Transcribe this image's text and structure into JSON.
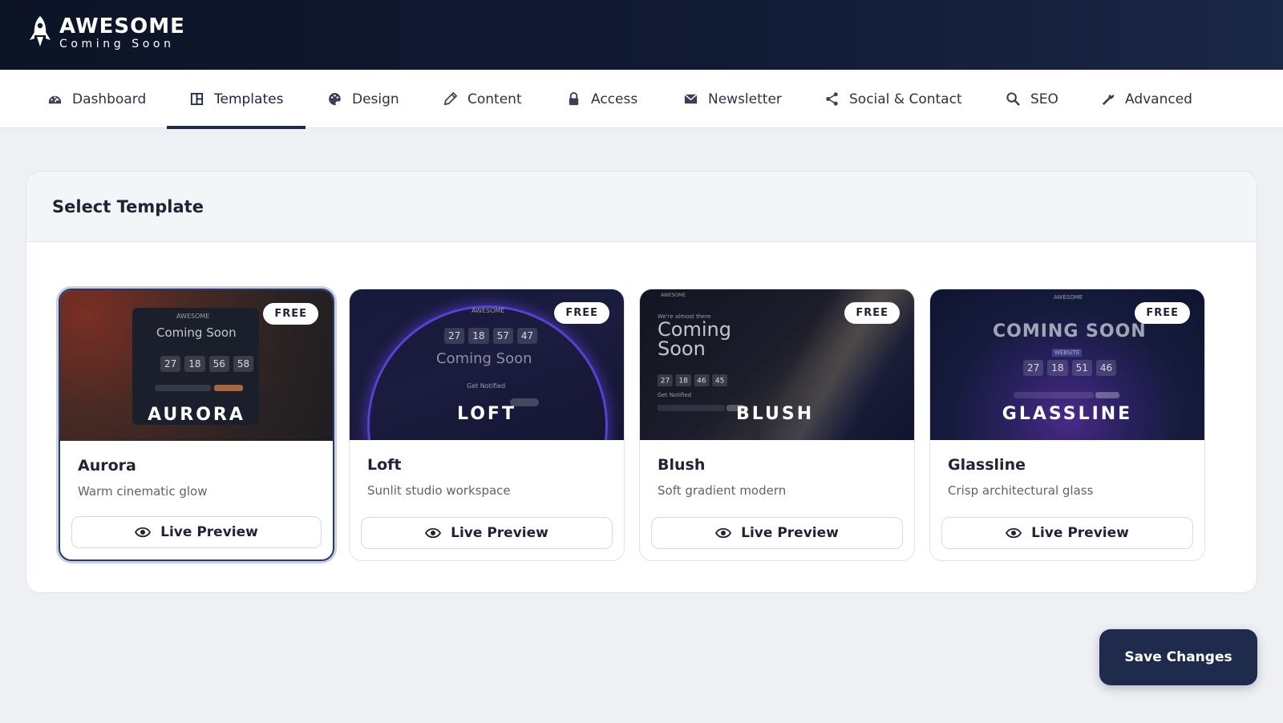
{
  "header": {
    "brand_title": "AWESOME",
    "brand_subtitle": "Coming Soon"
  },
  "nav": {
    "items": [
      {
        "label": "Dashboard",
        "icon": "dashboard-gauge-icon"
      },
      {
        "label": "Templates",
        "icon": "templates-grid-icon",
        "active": true
      },
      {
        "label": "Design",
        "icon": "palette-icon"
      },
      {
        "label": "Content",
        "icon": "pencil-icon"
      },
      {
        "label": "Access",
        "icon": "lock-icon"
      },
      {
        "label": "Newsletter",
        "icon": "envelope-icon"
      },
      {
        "label": "Social & Contact",
        "icon": "share-icon"
      },
      {
        "label": "SEO",
        "icon": "search-icon"
      },
      {
        "label": "Advanced",
        "icon": "wrench-icon"
      }
    ]
  },
  "panel": {
    "title": "Select Template"
  },
  "templates": [
    {
      "name": "Aurora",
      "thumb_label": "AURORA",
      "description": "Warm cinematic glow",
      "badge": "FREE",
      "preview_label": "Live Preview",
      "selected": true,
      "thumb_text": {
        "brand": "AWESOME",
        "heading": "Coming Soon",
        "countdown": [
          "27",
          "18",
          "56",
          "58"
        ]
      }
    },
    {
      "name": "Loft",
      "thumb_label": "LOFT",
      "description": "Sunlit studio workspace",
      "badge": "FREE",
      "preview_label": "Live Preview",
      "selected": false,
      "thumb_text": {
        "brand": "AWESOME",
        "heading": "Coming Soon",
        "countdown": [
          "27",
          "18",
          "57",
          "47"
        ],
        "notify": "Get Notified"
      }
    },
    {
      "name": "Blush",
      "thumb_label": "BLUSH",
      "description": "Soft gradient modern",
      "badge": "FREE",
      "preview_label": "Live Preview",
      "selected": false,
      "thumb_text": {
        "brand": "AWESOME",
        "eyebrow": "We're almost there",
        "heading_line1": "Coming",
        "heading_line2": "Soon",
        "countdown": [
          "27",
          "18",
          "46",
          "45"
        ],
        "notify": "Get Notified"
      }
    },
    {
      "name": "Glassline",
      "thumb_label": "GLASSLINE",
      "description": "Crisp architectural glass",
      "badge": "FREE",
      "preview_label": "Live Preview",
      "selected": false,
      "thumb_text": {
        "brand": "AWESOME",
        "heading": "COMING SOON",
        "tag": "WEBSITE",
        "countdown": [
          "27",
          "18",
          "51",
          "46"
        ]
      }
    }
  ],
  "footer": {
    "save_label": "Save Changes"
  },
  "colors": {
    "header_bg": "#0c1426",
    "accent": "#1e2b4d",
    "nav_active": "#1f2c52"
  }
}
